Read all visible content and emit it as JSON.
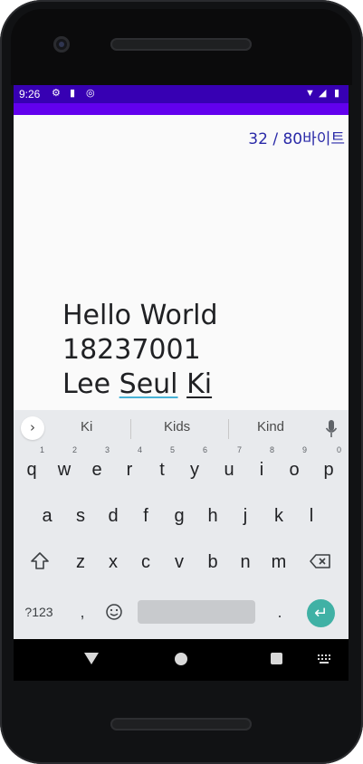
{
  "status_bar": {
    "time": "9:26",
    "left_icons": [
      "gear-icon",
      "sd-card-icon",
      "sync-icon"
    ],
    "right_icons": [
      "wifi-icon",
      "signal-icon",
      "battery-icon"
    ]
  },
  "app": {
    "byte_counter": "32 / 80바이트",
    "text_lines": {
      "line1": "Hello World",
      "line2": "18237001",
      "line3_word1": "Lee",
      "line3_word2": "Seul",
      "line3_word3": "Ki"
    }
  },
  "keyboard": {
    "suggestions": [
      "Ki",
      "Kids",
      "Kind"
    ],
    "row1": [
      {
        "key": "q",
        "hint": "1"
      },
      {
        "key": "w",
        "hint": "2"
      },
      {
        "key": "e",
        "hint": "3"
      },
      {
        "key": "r",
        "hint": "4"
      },
      {
        "key": "t",
        "hint": "5"
      },
      {
        "key": "y",
        "hint": "6"
      },
      {
        "key": "u",
        "hint": "7"
      },
      {
        "key": "i",
        "hint": "8"
      },
      {
        "key": "o",
        "hint": "9"
      },
      {
        "key": "p",
        "hint": "0"
      }
    ],
    "row2": [
      "a",
      "s",
      "d",
      "f",
      "g",
      "h",
      "j",
      "k",
      "l"
    ],
    "row3": [
      "z",
      "x",
      "c",
      "v",
      "b",
      "n",
      "m"
    ],
    "symbols_key": "?123",
    "comma_key": ",",
    "period_key": "."
  },
  "colors": {
    "status_bar": "#3700b3",
    "app_bar": "#6200ee",
    "counter_text": "#2a2aa8",
    "enter_key": "#40b1a5",
    "underline_blue": "#47b2d6"
  }
}
